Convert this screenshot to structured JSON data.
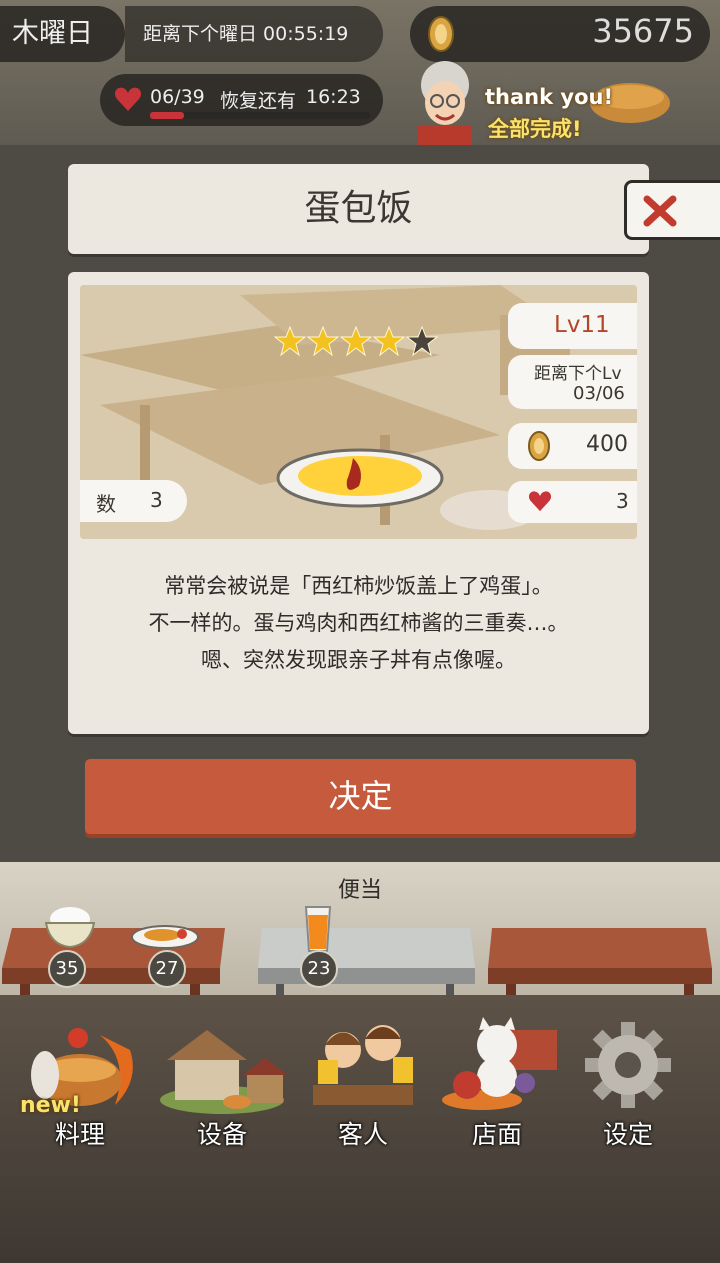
{
  "hud": {
    "day": "木曜日",
    "next_day_label": "距离下个曜日 00:55:19",
    "stamina": "06/39",
    "stamina_fraction": 0.154,
    "recover_label": "恢复还有",
    "recover_time": "16:23",
    "coins": "35675",
    "banner_line1": "thank you!",
    "banner_line2": "全部完成!"
  },
  "dialog": {
    "title": "蛋包饭",
    "stars_filled": 4,
    "stars_total": 5,
    "level": "Lv11",
    "next_lv_label": "距离下个Lv",
    "next_lv_progress": "03/06",
    "price": "400",
    "hearts": "3",
    "count_label": "数",
    "count_value": "3",
    "description": [
      "常常会被说是「西红柿炒饭盖上了鸡蛋」。",
      "不一样的。蛋与鸡肉和西红柿酱的三重奏…。",
      "嗯、突然发现跟亲子丼有点像喔。"
    ],
    "confirm_label": "决定"
  },
  "shelf": {
    "category": "便当",
    "items": [
      {
        "icon": "rice-bowl-icon",
        "count": "35"
      },
      {
        "icon": "fried-fish-plate-icon",
        "count": "27"
      },
      {
        "icon": "orange-juice-icon",
        "count": "23"
      }
    ]
  },
  "nav": {
    "items": [
      {
        "label": "料理",
        "badge": "new!"
      },
      {
        "label": "设备"
      },
      {
        "label": "客人"
      },
      {
        "label": "店面"
      },
      {
        "label": "设定"
      }
    ]
  },
  "colors": {
    "accent": "#c65a3c",
    "level_text": "#b3452a",
    "heart": "#c8343a",
    "star": "#f4c21f"
  }
}
